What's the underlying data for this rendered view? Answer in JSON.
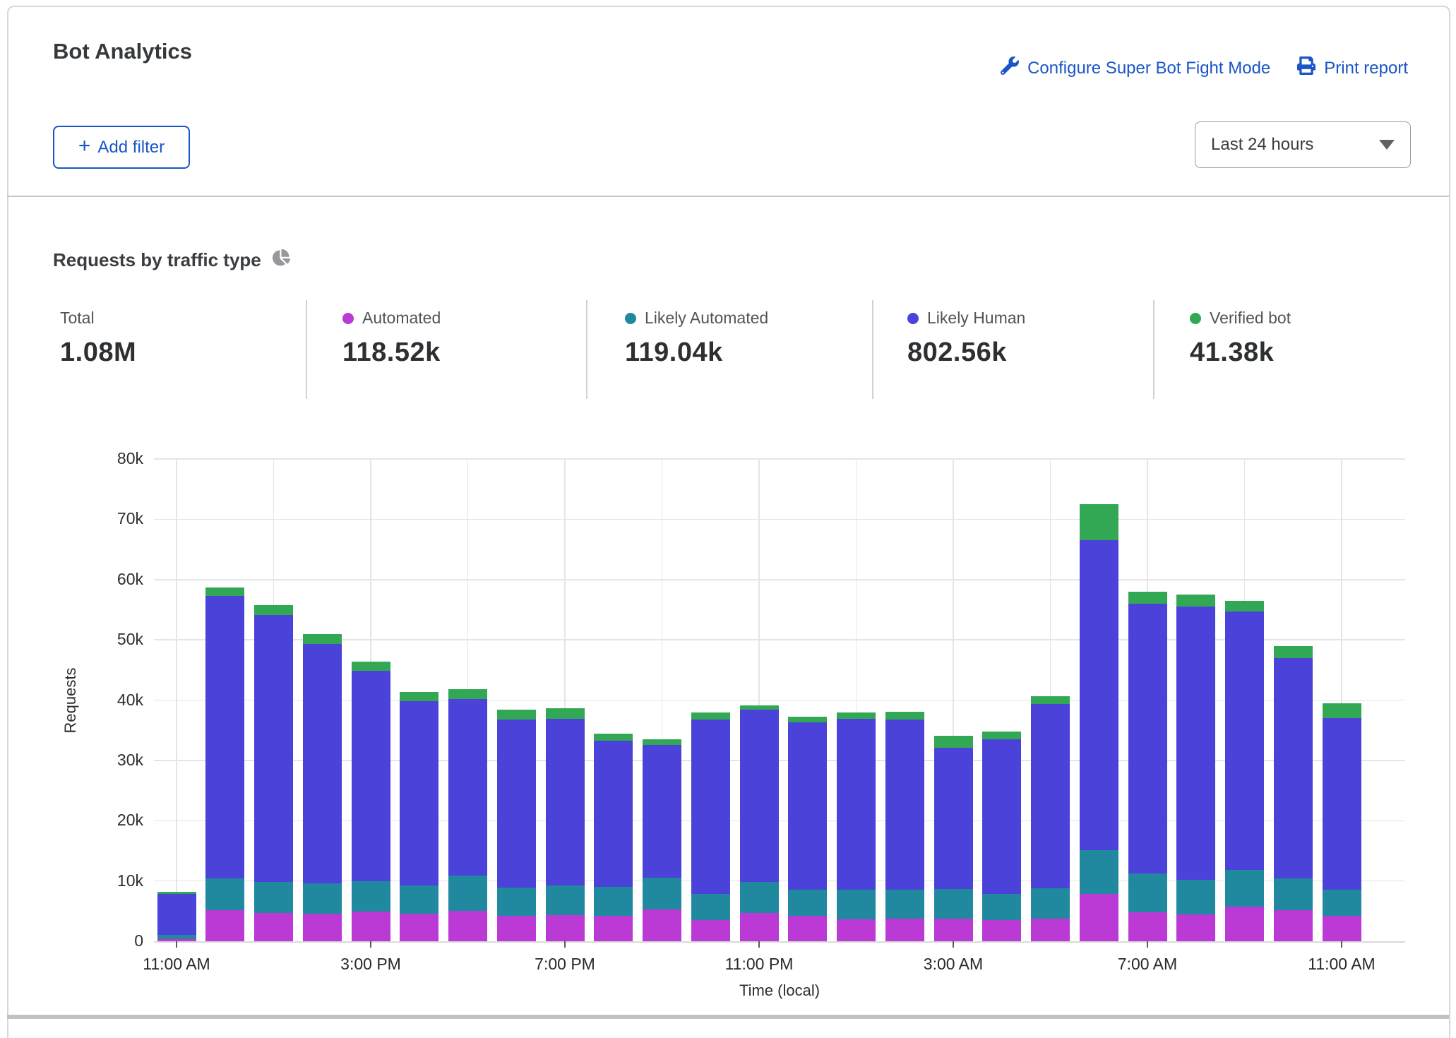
{
  "header": {
    "title": "Bot Analytics",
    "links": [
      {
        "label": "Configure Super Bot Fight Mode",
        "icon": "wrench-icon"
      },
      {
        "label": "Print report",
        "icon": "printer-icon"
      }
    ],
    "add_filter_plus": "+",
    "add_filter_label": "Add filter",
    "time_range": "Last 24 hours"
  },
  "section": {
    "title": "Requests by traffic type",
    "icon": "pie-chart-icon"
  },
  "stats": [
    {
      "label": "Total",
      "value": "1.08M",
      "color": null
    },
    {
      "label": "Automated",
      "value": "118.52k",
      "color": "#bb39d4"
    },
    {
      "label": "Likely Automated",
      "value": "119.04k",
      "color": "#2089a0"
    },
    {
      "label": "Likely Human",
      "value": "802.56k",
      "color": "#4b42d9"
    },
    {
      "label": "Verified bot",
      "value": "41.38k",
      "color": "#32a854"
    }
  ],
  "chart_data": {
    "type": "bar",
    "stacked": true,
    "title": "Requests by traffic type",
    "xlabel": "Time (local)",
    "ylabel": "Requests",
    "ylim": [
      0,
      80000
    ],
    "grid": true,
    "legend_position": "top",
    "ytick_labels": [
      "0",
      "10k",
      "20k",
      "30k",
      "40k",
      "50k",
      "60k",
      "70k",
      "80k"
    ],
    "categories": [
      "11:00 AM",
      "12:00 PM",
      "1:00 PM",
      "2:00 PM",
      "3:00 PM",
      "4:00 PM",
      "5:00 PM",
      "6:00 PM",
      "7:00 PM",
      "8:00 PM",
      "9:00 PM",
      "10:00 PM",
      "11:00 PM",
      "12:00 AM",
      "1:00 AM",
      "2:00 AM",
      "3:00 AM",
      "4:00 AM",
      "5:00 AM",
      "6:00 AM",
      "7:00 AM",
      "8:00 AM",
      "9:00 AM",
      "10:00 AM",
      "11:00 AM"
    ],
    "x_ticks": [
      {
        "index": 0,
        "label": "11:00 AM"
      },
      {
        "index": 4,
        "label": "3:00 PM"
      },
      {
        "index": 8,
        "label": "7:00 PM"
      },
      {
        "index": 12,
        "label": "11:00 PM"
      },
      {
        "index": 16,
        "label": "3:00 AM"
      },
      {
        "index": 20,
        "label": "7:00 AM"
      },
      {
        "index": 24,
        "label": "11:00 AM"
      }
    ],
    "series": [
      {
        "name": "Automated",
        "color": "#bb39d4",
        "values": [
          400,
          5200,
          4700,
          4600,
          4900,
          4600,
          5000,
          4200,
          4300,
          4200,
          5300,
          3500,
          4700,
          4200,
          3600,
          3800,
          3700,
          3500,
          3800,
          7900,
          4800,
          4400,
          5700,
          5100,
          4200
        ]
      },
      {
        "name": "Likely Automated",
        "color": "#2089a0",
        "values": [
          700,
          5200,
          5100,
          5000,
          5000,
          4700,
          5900,
          4700,
          4900,
          4800,
          5200,
          4400,
          5100,
          4400,
          5000,
          4800,
          5000,
          4300,
          5000,
          7200,
          6400,
          5800,
          6100,
          5300,
          4400
        ]
      },
      {
        "name": "Likely Human",
        "color": "#4b42d9",
        "values": [
          6800,
          46900,
          44300,
          39700,
          35000,
          30500,
          29300,
          27900,
          27700,
          24300,
          22100,
          28900,
          28600,
          27700,
          28300,
          28200,
          23400,
          25700,
          30500,
          51400,
          44800,
          45300,
          42900,
          36600,
          28400
        ]
      },
      {
        "name": "Verified bot",
        "color": "#32a854",
        "values": [
          300,
          1400,
          1600,
          1700,
          1500,
          1500,
          1600,
          1600,
          1800,
          1100,
          900,
          1100,
          700,
          1000,
          1000,
          1300,
          2000,
          1300,
          1300,
          6000,
          2000,
          2000,
          1800,
          2000,
          2500
        ]
      }
    ]
  }
}
